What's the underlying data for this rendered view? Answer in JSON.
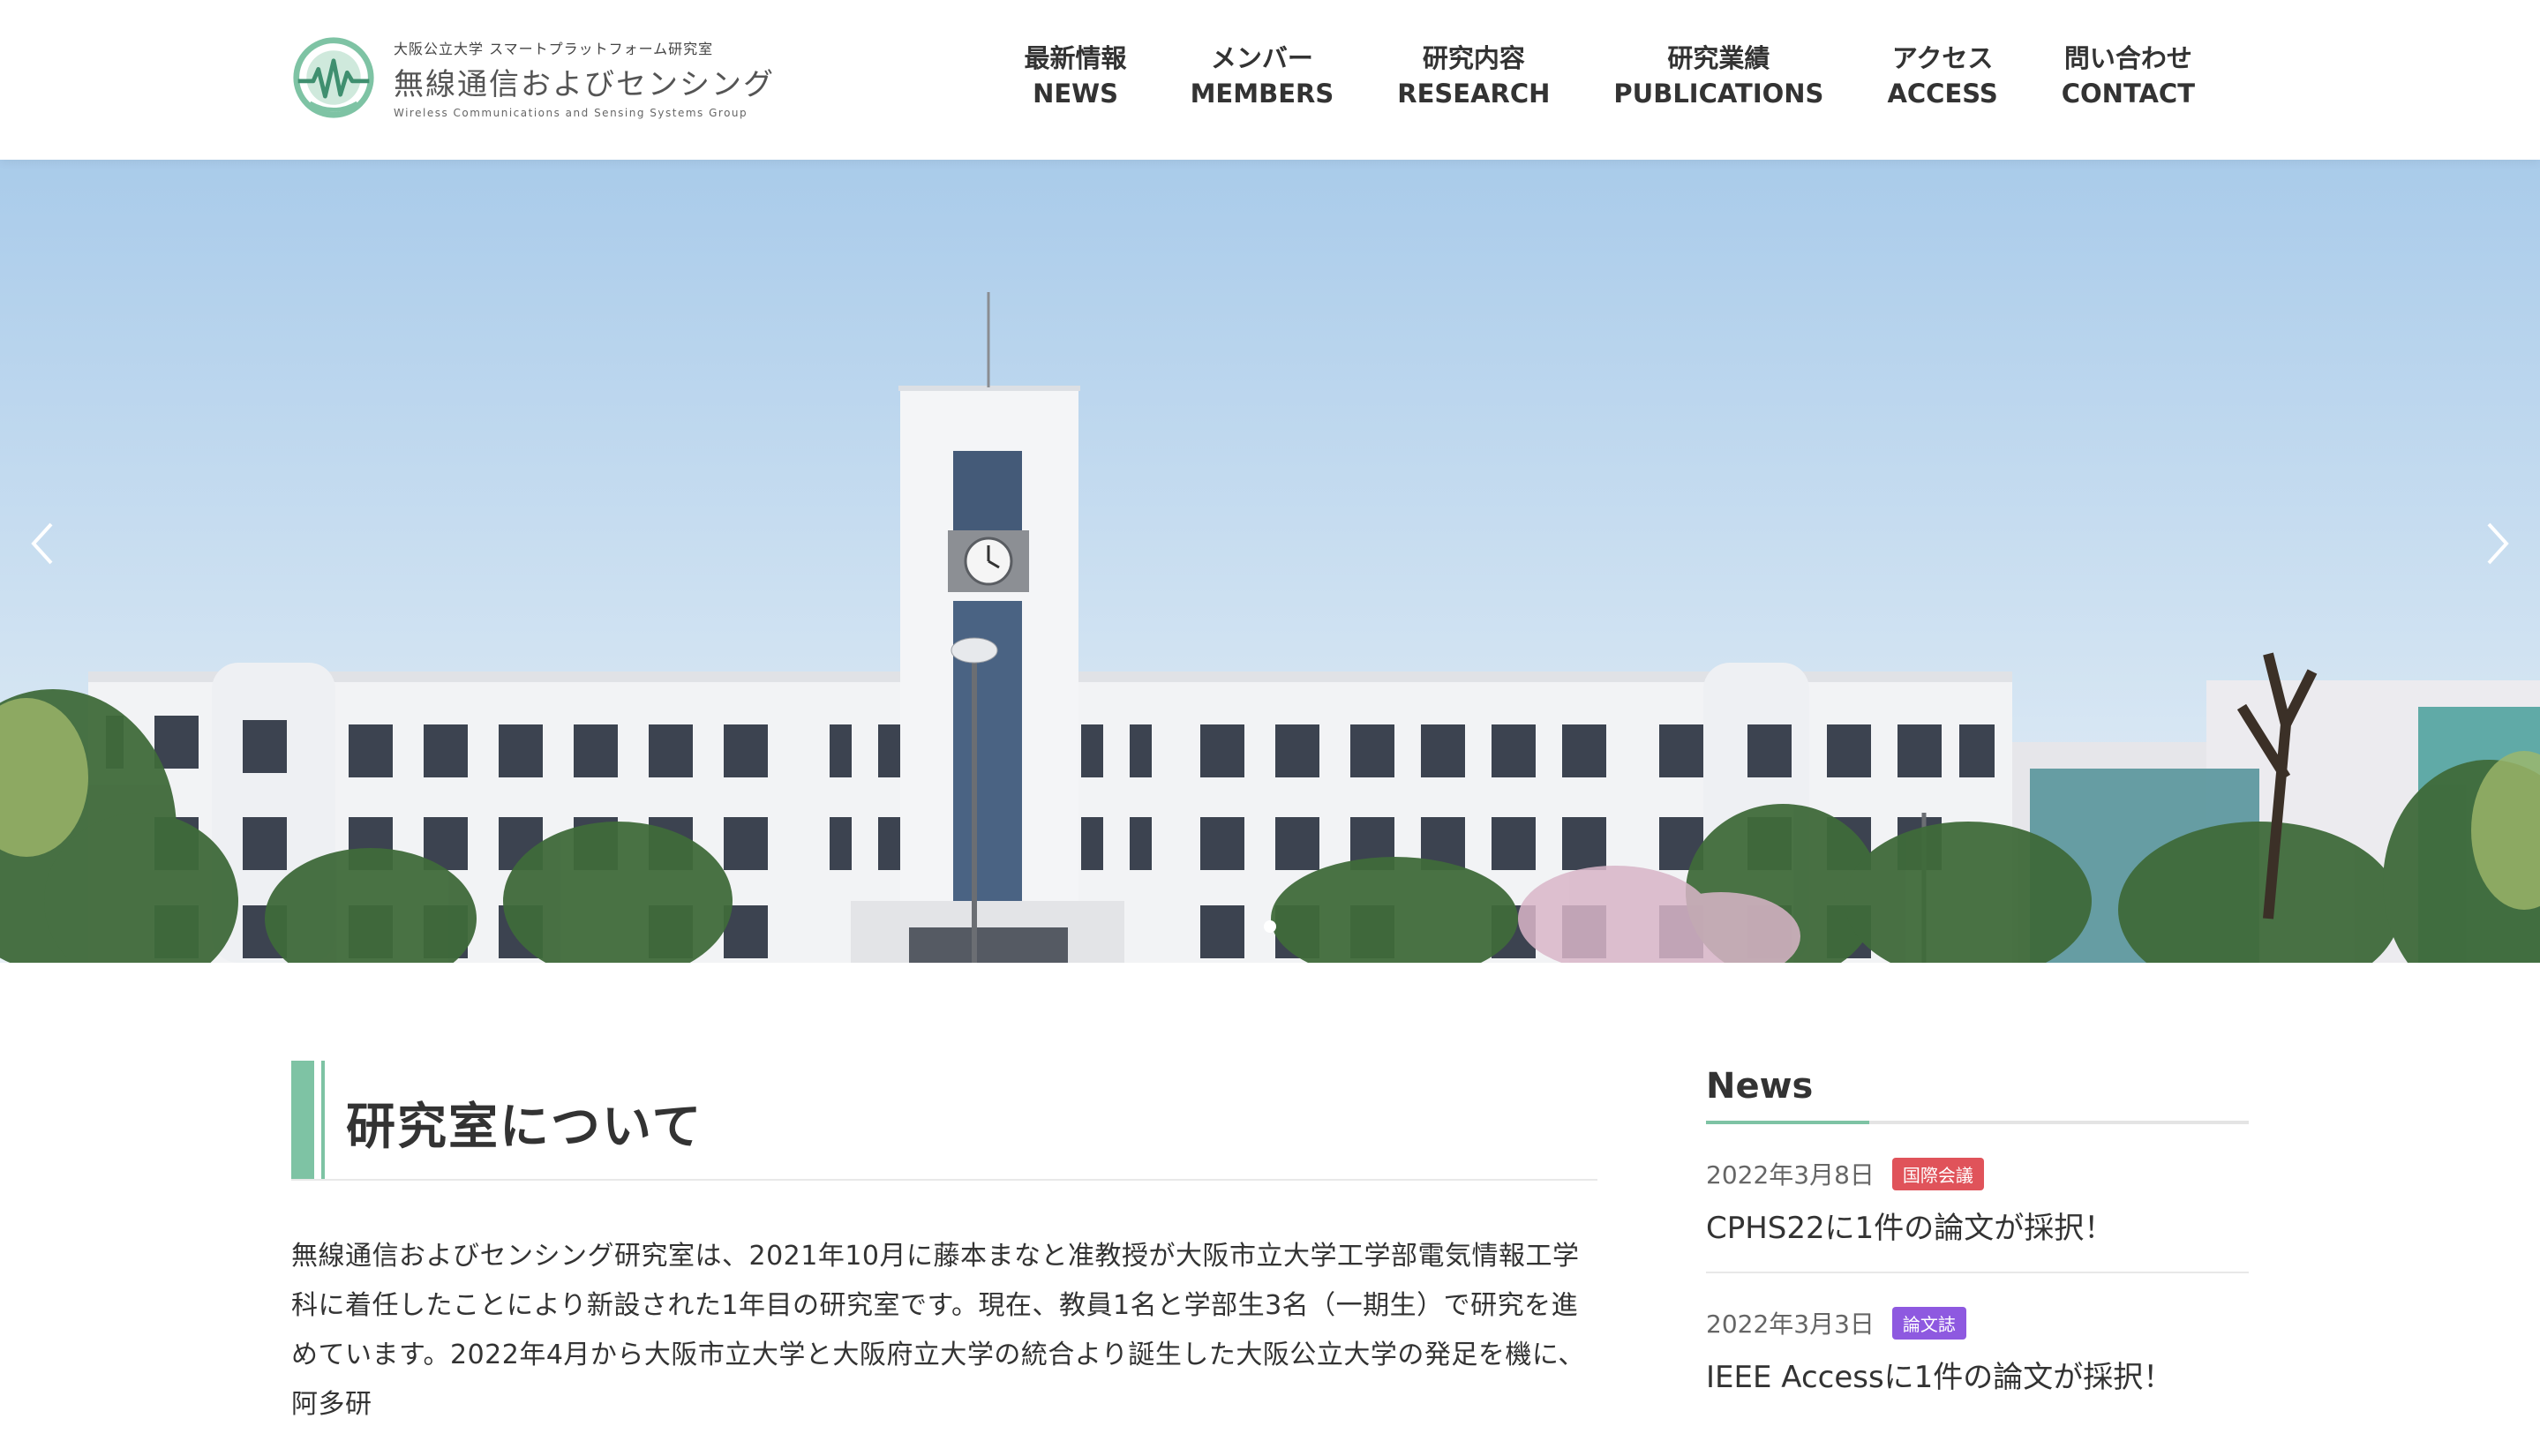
{
  "colors": {
    "accent": "#7ec3a4",
    "badge_conference": "#e0535a",
    "badge_journal": "#8e59e0",
    "text": "#333333"
  },
  "logo": {
    "sub": "大阪公立大学 スマートプラットフォーム研究室",
    "main": "無線通信およびセンシング",
    "en": "Wireless Communications and Sensing Systems Group"
  },
  "nav": {
    "items": [
      {
        "jp": "最新情報",
        "en": "NEWS"
      },
      {
        "jp": "メンバー",
        "en": "MEMBERS"
      },
      {
        "jp": "研究内容",
        "en": "RESEARCH"
      },
      {
        "jp": "研究業績",
        "en": "PUBLICATIONS"
      },
      {
        "jp": "アクセス",
        "en": "ACCESS"
      },
      {
        "jp": "問い合わせ",
        "en": "CONTACT"
      }
    ]
  },
  "hero": {
    "prev_icon": "chevron-left-icon",
    "next_icon": "chevron-right-icon",
    "slide_count": 1,
    "active_slide": 1
  },
  "about": {
    "title": "研究室について",
    "body": "無線通信およびセンシング研究室は、2021年10月に藤本まなと准教授が大阪市立大学工学部電気情報工学科に着任したことにより新設された1年目の研究室です。現在、教員1名と学部生3名（一期生）で研究を進めています。2022年4月から大阪市立大学と大阪府立大学の統合より誕生した大阪公立大学の発足を機に、阿多研"
  },
  "news": {
    "title": "News",
    "items": [
      {
        "date": "2022年3月8日",
        "badge": "国際会議",
        "headline": "CPHS22に1件の論文が採択！"
      },
      {
        "date": "2022年3月3日",
        "badge": "論文誌",
        "headline": "IEEE Accessに1件の論文が採択！"
      }
    ]
  }
}
